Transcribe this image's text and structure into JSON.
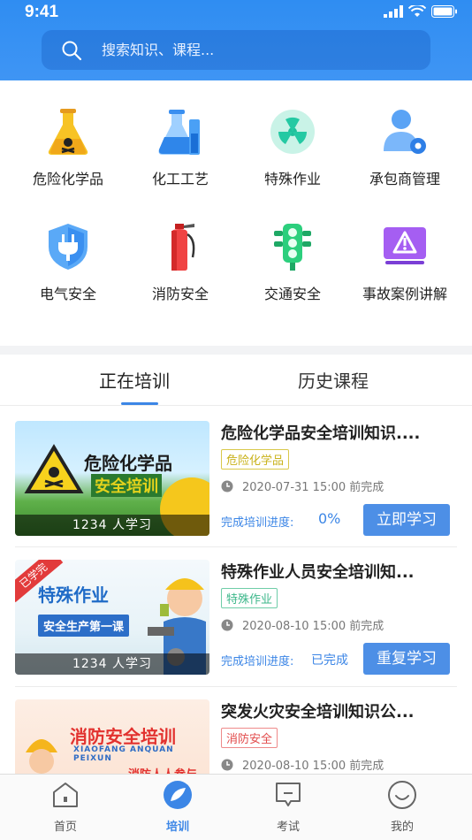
{
  "status": {
    "time": "9:41"
  },
  "search": {
    "placeholder": "搜索知识、课程..."
  },
  "categories": [
    {
      "label": "危险化学品",
      "icon": "hazard-flask-icon"
    },
    {
      "label": "化工工艺",
      "icon": "lab-flask-icon"
    },
    {
      "label": "特殊作业",
      "icon": "radiation-icon"
    },
    {
      "label": "承包商管理",
      "icon": "user-gear-icon"
    },
    {
      "label": "电气安全",
      "icon": "plug-shield-icon"
    },
    {
      "label": "消防安全",
      "icon": "fire-extinguisher-icon"
    },
    {
      "label": "交通安全",
      "icon": "traffic-light-icon"
    },
    {
      "label": "事故案例讲解",
      "icon": "warning-monitor-icon"
    }
  ],
  "tabs": [
    {
      "label": "正在培训"
    },
    {
      "label": "历史课程"
    }
  ],
  "courses": [
    {
      "title": "危险化学品安全培训知识....",
      "tag": "危险化学品",
      "tag_color": "#c9b21a",
      "thumb_title": "危险化学品",
      "thumb_sub": "安全培训",
      "learners": "1234 人学习",
      "due": "2020-07-31 15:00 前完成",
      "progress_label": "完成培训进度:",
      "progress_value": "0%",
      "action": "立即学习"
    },
    {
      "title": "特殊作业人员安全培训知...",
      "tag": "特殊作业",
      "tag_color": "#3cb78a",
      "thumb_title": "特殊作业",
      "thumb_sub": "安全生产第一课",
      "ribbon": "已学完",
      "learners": "1234 人学习",
      "due": "2020-08-10 15:00 前完成",
      "progress_label": "完成培训进度:",
      "progress_value": "已完成",
      "action": "重复学习"
    },
    {
      "title": "突发火灾安全培训知识公...",
      "tag": "消防安全",
      "tag_color": "#e24b4b",
      "thumb_title": "消防安全培训",
      "thumb_pinyin": "XIAOFANG ANQUAN PEIXUN",
      "thumb_sub": "消防人人参与",
      "due": "2020-08-10 15:00 前完成"
    }
  ],
  "nav": [
    {
      "label": "首页",
      "icon": "home-icon"
    },
    {
      "label": "培训",
      "icon": "training-icon"
    },
    {
      "label": "考试",
      "icon": "exam-icon"
    },
    {
      "label": "我的",
      "icon": "profile-icon"
    }
  ],
  "colors": {
    "primary": "#3c86e6",
    "header": "#2f8df2"
  }
}
